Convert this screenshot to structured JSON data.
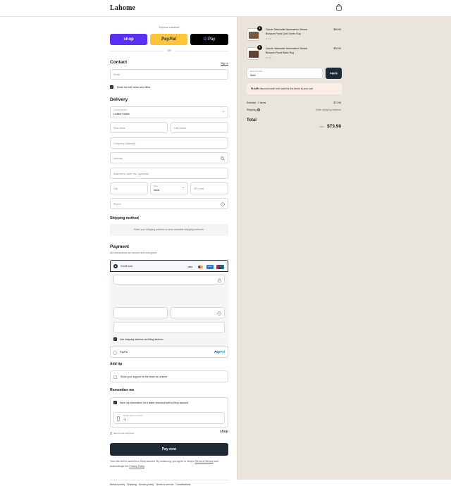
{
  "header": {
    "brand": "Lahome"
  },
  "express": {
    "title": "Express checkout",
    "shop_label": "shop",
    "paypal_label": "PayPal",
    "gpay_label": "Pay",
    "or": "OR",
    "colors": {
      "shop": "#5a31f4",
      "paypal": "#ffc439",
      "gpay": "#000000"
    }
  },
  "contact": {
    "title": "Contact",
    "sign_in": "Sign in",
    "email_placeholder": "Email",
    "news_label": "Email me with news and offers"
  },
  "delivery": {
    "title": "Delivery",
    "country_label": "Country/Region",
    "country_value": "United States",
    "first_name": "First name",
    "last_name": "Last name",
    "company": "Company (optional)",
    "address": "Address",
    "apartment": "Apartment, suite, etc. (optional)",
    "city": "City",
    "state_label": "State",
    "state_value": "Iowa",
    "zip": "ZIP code",
    "phone": "Phone"
  },
  "shipping_method": {
    "title": "Shipping method",
    "notice": "Enter your shipping address to view available shipping methods."
  },
  "payment": {
    "title": "Payment",
    "subtitle": "All transactions are secure and encrypted.",
    "credit_card": "Credit card",
    "card_brands": [
      "VISA",
      "MC",
      "AMEX",
      "UP"
    ],
    "billing_same": "Use shipping address as billing address",
    "paypal": "PayPal"
  },
  "tip": {
    "title": "Add tip",
    "label": "Show your support for the team at Lahome"
  },
  "remember": {
    "title": "Remember me",
    "save_label": "Save my information for a faster checkout with a Shop account",
    "phone_label": "Mobile phone number",
    "phone_value": "+1",
    "secure": "Secure and encrypted",
    "shop": "shop"
  },
  "pay_button": "Pay now",
  "legal": {
    "text1": "Your info will be saved to a Shop account. By continuing, you agree to Shop's",
    "terms": "Terms of Service",
    "text2": "and acknowledge the",
    "privacy": "Privacy Policy",
    "end": "."
  },
  "footer_links": [
    "Refund policy",
    "Shipping",
    "Privacy policy",
    "Terms of service",
    "Cancellations"
  ],
  "cart": {
    "items": [
      {
        "qty": "1",
        "name_line1": "Claude Washable Maximalism Vibrant",
        "name_line2": "Blossom Floral Dark Green Rug",
        "variant": "2' x 3'",
        "price": "$36.99"
      },
      {
        "qty": "1",
        "name_line1": "Claude Washable Maximalism Vibrant",
        "name_line2": "Blossom Floral Black Rug",
        "variant": "2' x 3'",
        "price": "$36.99"
      }
    ],
    "discount_label": "Discount code",
    "discount_value": "flash",
    "apply": "Apply",
    "alert_code": "FLASH",
    "alert_text": "discount code isn't valid for the items in your cart",
    "subtotal_label": "Subtotal · 2 items",
    "subtotal_value": "$73.98",
    "shipping_label": "Shipping",
    "shipping_value": "Enter shipping address",
    "total_label": "Total",
    "currency": "USD",
    "total_value": "$73.98"
  }
}
